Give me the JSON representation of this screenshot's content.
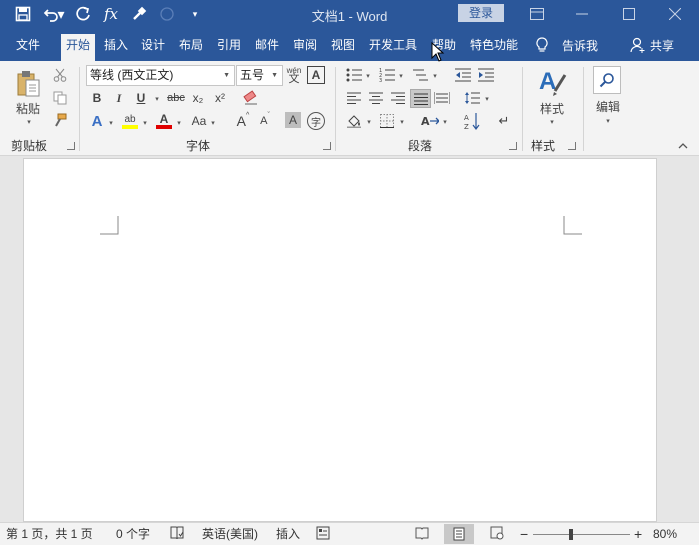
{
  "titlebar": {
    "title": "文档1  -  Word",
    "login": "登录",
    "fx": "fx"
  },
  "tabs": [
    {
      "label": "文件"
    },
    {
      "label": "开始"
    },
    {
      "label": "插入"
    },
    {
      "label": "设计"
    },
    {
      "label": "布局"
    },
    {
      "label": "引用"
    },
    {
      "label": "邮件"
    },
    {
      "label": "审阅"
    },
    {
      "label": "视图"
    },
    {
      "label": "开发工具"
    },
    {
      "label": "帮助"
    },
    {
      "label": "特色功能"
    }
  ],
  "tell_me": "告诉我",
  "share": "共享",
  "ribbon": {
    "clipboard": {
      "paste": "粘贴",
      "label": "剪贴板"
    },
    "font": {
      "name": "等线 (西文正文)",
      "size": "五号",
      "wen": "wén",
      "wen_char": "文",
      "bold": "B",
      "italic": "I",
      "underline": "U",
      "strike": "abc",
      "sub": "x₂",
      "sup": "x²",
      "highlight": "ab",
      "color_a": "A",
      "case": "Aa",
      "grow": "A",
      "shrink": "A",
      "shade": "A",
      "enclose": "字",
      "label": "字体"
    },
    "paragraph": {
      "label": "段落"
    },
    "styles": {
      "btn": "样式",
      "label": "样式"
    },
    "editing": {
      "btn": "编辑"
    }
  },
  "statusbar": {
    "page": "第 1 页，共 1 页",
    "words": "0 个字",
    "language": "英语(美国)",
    "mode": "插入",
    "zoom": "80%",
    "minus": "−",
    "plus": "+"
  },
  "colors": {
    "accent": "#2b579a",
    "ribbon": "#f3f3f3",
    "highlight": "#ffff00",
    "font_color": "#e00000"
  }
}
